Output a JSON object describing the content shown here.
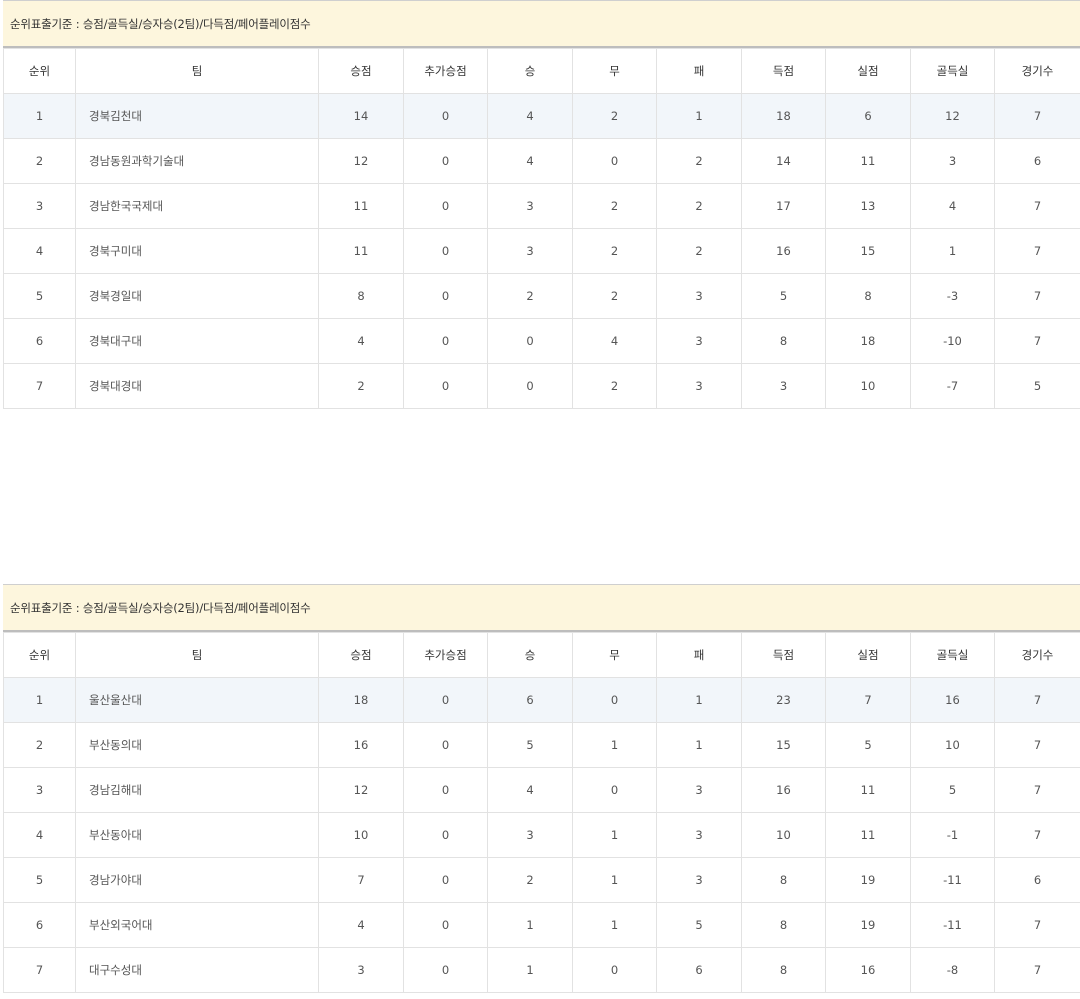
{
  "criteria_text": "순위표출기준 : 승점/골득실/승자승(2팀)/다득점/페어플레이점수",
  "columns": [
    "순위",
    "팀",
    "승점",
    "추가승점",
    "승",
    "무",
    "패",
    "득점",
    "실점",
    "골득실",
    "경기수"
  ],
  "table1": {
    "rows": [
      [
        "1",
        "경북김천대",
        "14",
        "0",
        "4",
        "2",
        "1",
        "18",
        "6",
        "12",
        "7"
      ],
      [
        "2",
        "경남동원과학기술대",
        "12",
        "0",
        "4",
        "0",
        "2",
        "14",
        "11",
        "3",
        "6"
      ],
      [
        "3",
        "경남한국국제대",
        "11",
        "0",
        "3",
        "2",
        "2",
        "17",
        "13",
        "4",
        "7"
      ],
      [
        "4",
        "경북구미대",
        "11",
        "0",
        "3",
        "2",
        "2",
        "16",
        "15",
        "1",
        "7"
      ],
      [
        "5",
        "경북경일대",
        "8",
        "0",
        "2",
        "2",
        "3",
        "5",
        "8",
        "-3",
        "7"
      ],
      [
        "6",
        "경북대구대",
        "4",
        "0",
        "0",
        "4",
        "3",
        "8",
        "18",
        "-10",
        "7"
      ],
      [
        "7",
        "경북대경대",
        "2",
        "0",
        "0",
        "2",
        "3",
        "3",
        "10",
        "-7",
        "5"
      ]
    ]
  },
  "table2": {
    "rows": [
      [
        "1",
        "울산울산대",
        "18",
        "0",
        "6",
        "0",
        "1",
        "23",
        "7",
        "16",
        "7"
      ],
      [
        "2",
        "부산동의대",
        "16",
        "0",
        "5",
        "1",
        "1",
        "15",
        "5",
        "10",
        "7"
      ],
      [
        "3",
        "경남김해대",
        "12",
        "0",
        "4",
        "0",
        "3",
        "16",
        "11",
        "5",
        "7"
      ],
      [
        "4",
        "부산동아대",
        "10",
        "0",
        "3",
        "1",
        "3",
        "10",
        "11",
        "-1",
        "7"
      ],
      [
        "5",
        "경남가야대",
        "7",
        "0",
        "2",
        "1",
        "3",
        "8",
        "19",
        "-11",
        "6"
      ],
      [
        "6",
        "부산외국어대",
        "4",
        "0",
        "1",
        "1",
        "5",
        "8",
        "19",
        "-11",
        "7"
      ],
      [
        "7",
        "대구수성대",
        "3",
        "0",
        "1",
        "0",
        "6",
        "8",
        "16",
        "-8",
        "7"
      ]
    ]
  }
}
